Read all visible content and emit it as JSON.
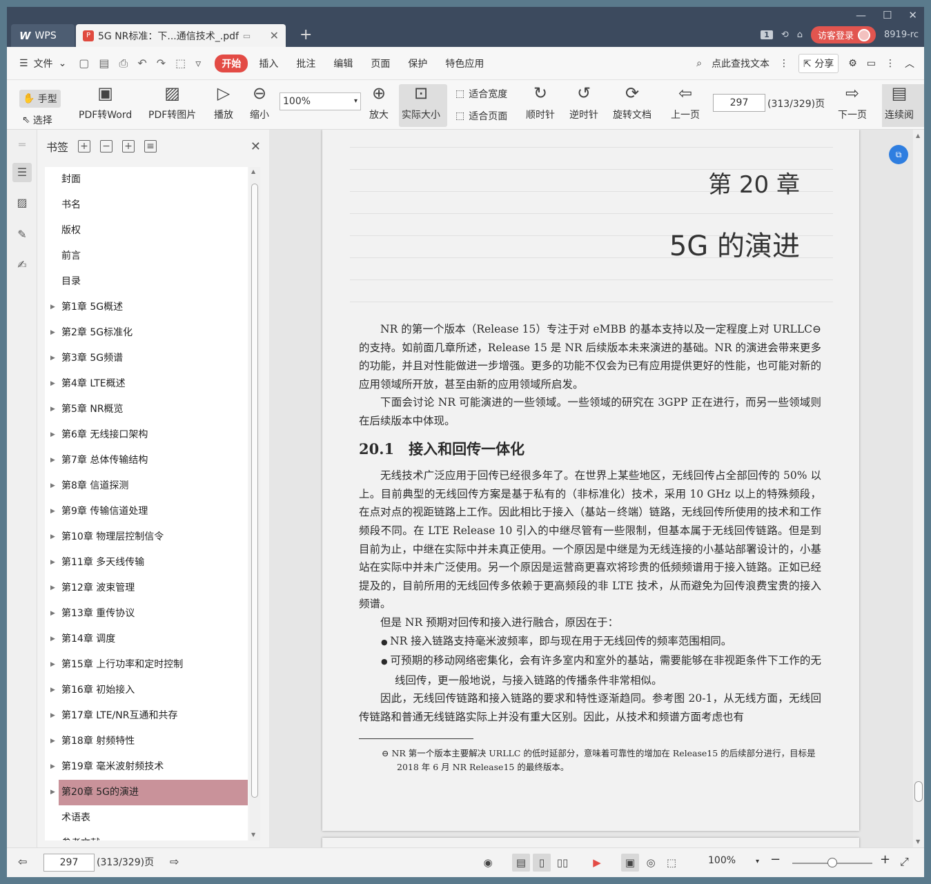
{
  "titlebar": {
    "app_tab": "WPS",
    "doc_tab": "5G NR标准：下...通信技术_.pdf",
    "new_tab": "+",
    "page_badge": "1",
    "login": "访客登录",
    "user_id": "8919-rc"
  },
  "menubar": {
    "file": "文件",
    "tabs": [
      "开始",
      "插入",
      "批注",
      "编辑",
      "页面",
      "保护",
      "特色应用"
    ],
    "search": "点此查找文本",
    "share": "分享"
  },
  "toolbar": {
    "hand": "手型",
    "select": "选择",
    "pdf_to_word": "PDF转Word",
    "pdf_to_image": "PDF转图片",
    "play": "播放",
    "zoom_out": "缩小",
    "zoom_value": "100%",
    "zoom_in": "放大",
    "actual_size": "实际大小",
    "fit_width": "适合宽度",
    "fit_page": "适合页面",
    "clockwise": "顺时针",
    "counter_clockwise": "逆时针",
    "rotate_doc": "旋转文档",
    "prev_page": "上一页",
    "page_number": "297",
    "page_total": "(313/329)页",
    "next_page": "下一页",
    "continuous": "连续阅"
  },
  "panel": {
    "title": "书签",
    "bookmarks": [
      {
        "label": "封面",
        "expandable": false
      },
      {
        "label": "书名",
        "expandable": false
      },
      {
        "label": "版权",
        "expandable": false
      },
      {
        "label": "前言",
        "expandable": false
      },
      {
        "label": "目录",
        "expandable": false
      },
      {
        "label": "第1章 5G概述",
        "expandable": true
      },
      {
        "label": "第2章 5G标准化",
        "expandable": true
      },
      {
        "label": "第3章 5G频谱",
        "expandable": true
      },
      {
        "label": "第4章 LTE概述",
        "expandable": true
      },
      {
        "label": "第5章 NR概览",
        "expandable": true
      },
      {
        "label": "第6章 无线接口架构",
        "expandable": true
      },
      {
        "label": "第7章 总体传输结构",
        "expandable": true
      },
      {
        "label": "第8章 信道探测",
        "expandable": true
      },
      {
        "label": "第9章 传输信道处理",
        "expandable": true
      },
      {
        "label": "第10章 物理层控制信令",
        "expandable": true
      },
      {
        "label": "第11章 多天线传输",
        "expandable": true
      },
      {
        "label": "第12章 波束管理",
        "expandable": true
      },
      {
        "label": "第13章 重传协议",
        "expandable": true
      },
      {
        "label": "第14章 调度",
        "expandable": true
      },
      {
        "label": "第15章 上行功率和定时控制",
        "expandable": true
      },
      {
        "label": "第16章 初始接入",
        "expandable": true
      },
      {
        "label": "第17章 LTE/NR互通和共存",
        "expandable": true
      },
      {
        "label": "第18章 射频特性",
        "expandable": true
      },
      {
        "label": "第19章 毫米波射频技术",
        "expandable": true
      },
      {
        "label": "第20章 5G的演进",
        "expandable": true,
        "selected": true
      },
      {
        "label": "术语表",
        "expandable": false
      },
      {
        "label": "参考文献",
        "expandable": false
      }
    ]
  },
  "page": {
    "chapter_no": "第 20 章",
    "chapter_title": "5G 的演进",
    "para1": "NR 的第一个版本（Release 15）专注于对 eMBB 的基本支持以及一定程度上对 URLLC⊖的支持。如前面几章所述，Release 15 是 NR 后续版本未来演进的基础。NR 的演进会带来更多的功能，并且对性能做进一步增强。更多的功能不仅会为已有应用提供更好的性能，也可能对新的应用领域所开放，甚至由新的应用领域所启发。",
    "para2": "下面会讨论 NR 可能演进的一些领域。一些领域的研究在 3GPP 正在进行，而另一些领域则在后续版本中体现。",
    "section": "20.1　接入和回传一体化",
    "para3": "无线技术广泛应用于回传已经很多年了。在世界上某些地区，无线回传占全部回传的 50% 以上。目前典型的无线回传方案是基于私有的（非标准化）技术，采用 10 GHz 以上的特殊频段，在点对点的视距链路上工作。因此相比于接入（基站－终端）链路，无线回传所使用的技术和工作频段不同。在 LTE Release 10 引入的中继尽管有一些限制，但基本属于无线回传链路。但是到目前为止，中继在实际中并未真正使用。一个原因是中继是为无线连接的小基站部署设计的，小基站在实际中并未广泛使用。另一个原因是运营商更喜欢将珍贵的低频频谱用于接入链路。正如已经提及的，目前所用的无线回传多依赖于更高频段的非 LTE 技术，从而避免为回传浪费宝贵的接入频谱。",
    "para4": "但是 NR 预期对回传和接入进行融合，原因在于：",
    "bullet1": "NR 接入链路支持毫米波频率，即与现在用于无线回传的频率范围相同。",
    "bullet2": "可预期的移动网络密集化，会有许多室内和室外的基站，需要能够在非视距条件下工作的无线回传，更一般地说，与接入链路的传播条件非常相似。",
    "para5": "因此，无线回传链路和接入链路的要求和特性逐渐趋同。参考图 20-1，从无线方面，无线回传链路和普通无线链路实际上并没有重大区别。因此，从技术和频谱方面考虑也有",
    "footnote": "⊖ NR 第一个版本主要解决 URLLC 的低时延部分，意味着可靠性的增加在 Release15 的后续部分进行，目标是 2018 年 6 月 NR Release15 的最终版本。"
  },
  "statusbar": {
    "page_number": "297",
    "page_total": "(313/329)页",
    "zoom": "100%",
    "zoom_level_percent": 50
  },
  "colors": {
    "accent": "#e34b45",
    "titlebar": "#3c4a5e",
    "selected_bookmark": "#c9929a",
    "float_button": "#2f7ee0"
  }
}
